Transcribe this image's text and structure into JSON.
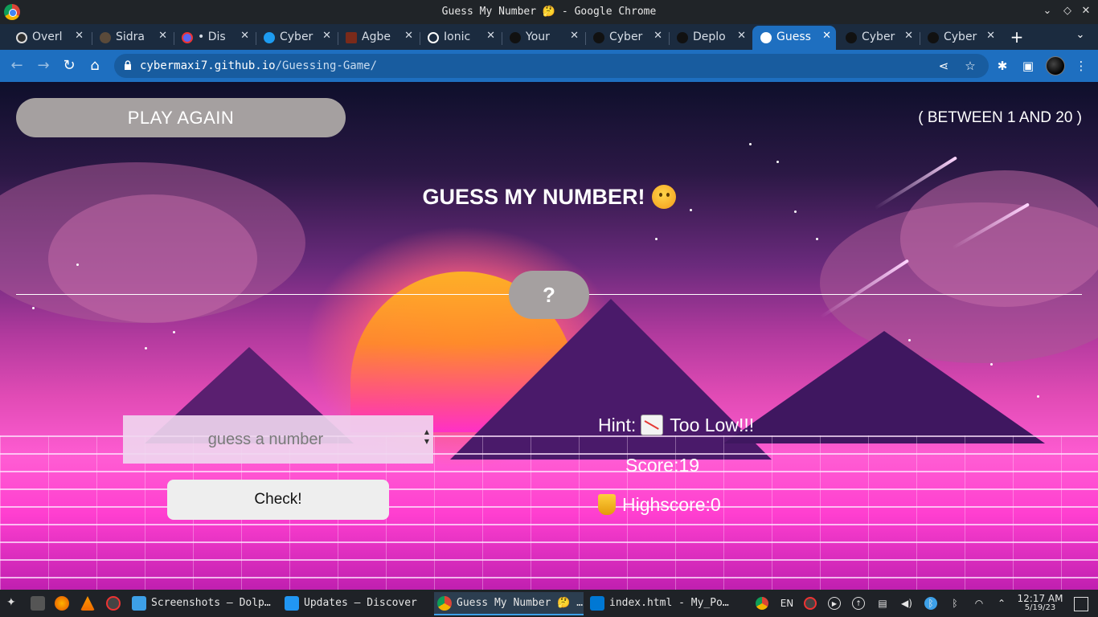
{
  "window": {
    "title": "Guess My Number 🤔 - Google Chrome"
  },
  "tabs": [
    {
      "label": "Overl",
      "icon": "overleaf-icon"
    },
    {
      "label": "Sidra",
      "icon": "site-icon"
    },
    {
      "label": "• Dis",
      "icon": "discord-icon"
    },
    {
      "label": "Cyber",
      "icon": "twitter-icon"
    },
    {
      "label": "Agbe",
      "icon": "site-icon"
    },
    {
      "label": "Ionic",
      "icon": "ionic-icon"
    },
    {
      "label": "Your",
      "icon": "github-icon"
    },
    {
      "label": "Cyber",
      "icon": "github-icon"
    },
    {
      "label": "Deplo",
      "icon": "github-icon"
    },
    {
      "label": "Guess",
      "icon": "globe-icon",
      "active": true
    },
    {
      "label": "Cyber",
      "icon": "github-icon"
    },
    {
      "label": "Cyber",
      "icon": "github-icon"
    }
  ],
  "address": {
    "host": "cybermaxi7.github.io",
    "path": "/Guessing-Game/"
  },
  "game": {
    "play_again": "PLAY AGAIN",
    "range": "( BETWEEN 1 AND 20 )",
    "heading": "GUESS MY NUMBER!",
    "secret": "?",
    "input_placeholder": "guess a number",
    "check": "Check!",
    "hint_label": "Hint:",
    "hint_text": "Too Low!!!",
    "score_text": "Score:19",
    "highscore_text": "Highscore:0"
  },
  "taskbar": {
    "tasks": [
      {
        "label": "Screenshots — Dolp…",
        "icon": "dolphin-icon"
      },
      {
        "label": "Updates — Discover",
        "icon": "discover-icon"
      },
      {
        "label": "Guess My Number 🤔 …",
        "icon": "chrome-icon",
        "active": true
      },
      {
        "label": "index.html - My_Po…",
        "icon": "vscode-icon"
      }
    ],
    "lang": "EN",
    "time": "12:17 AM",
    "date": "5/19/23"
  }
}
